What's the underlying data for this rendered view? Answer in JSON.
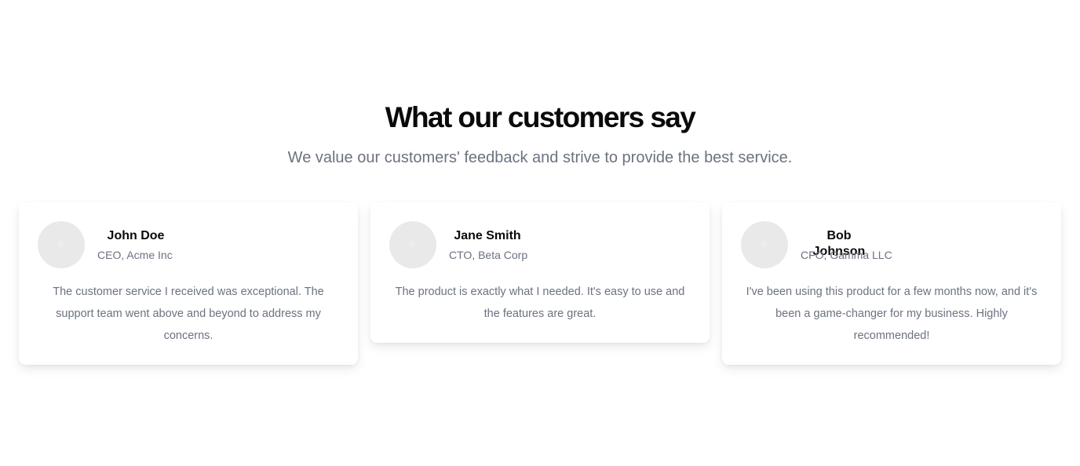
{
  "section": {
    "title": "What our customers say",
    "subtitle": "We value our customers' feedback and strive to provide the best service."
  },
  "testimonials": [
    {
      "name": "John Doe",
      "role": "CEO, Acme Inc",
      "quote": "The customer service I received was exceptional. The support team went above and beyond to address my concerns."
    },
    {
      "name": "Jane Smith",
      "role": "CTO, Beta Corp",
      "quote": "The product is exactly what I needed. It's easy to use and the features are great."
    },
    {
      "name": "Bob Johnson",
      "role": "CFO, Gamma LLC",
      "quote": "I've been using this product for a few months now, and it's been a game-changer for my business. Highly recommended!"
    }
  ],
  "icons": {
    "avatar": "avatar-placeholder-icon"
  },
  "colors": {
    "heading": "#0a0a0a",
    "muted_text": "#6b7280",
    "avatar_bg": "#e9e9e9",
    "card_bg": "#ffffff"
  }
}
